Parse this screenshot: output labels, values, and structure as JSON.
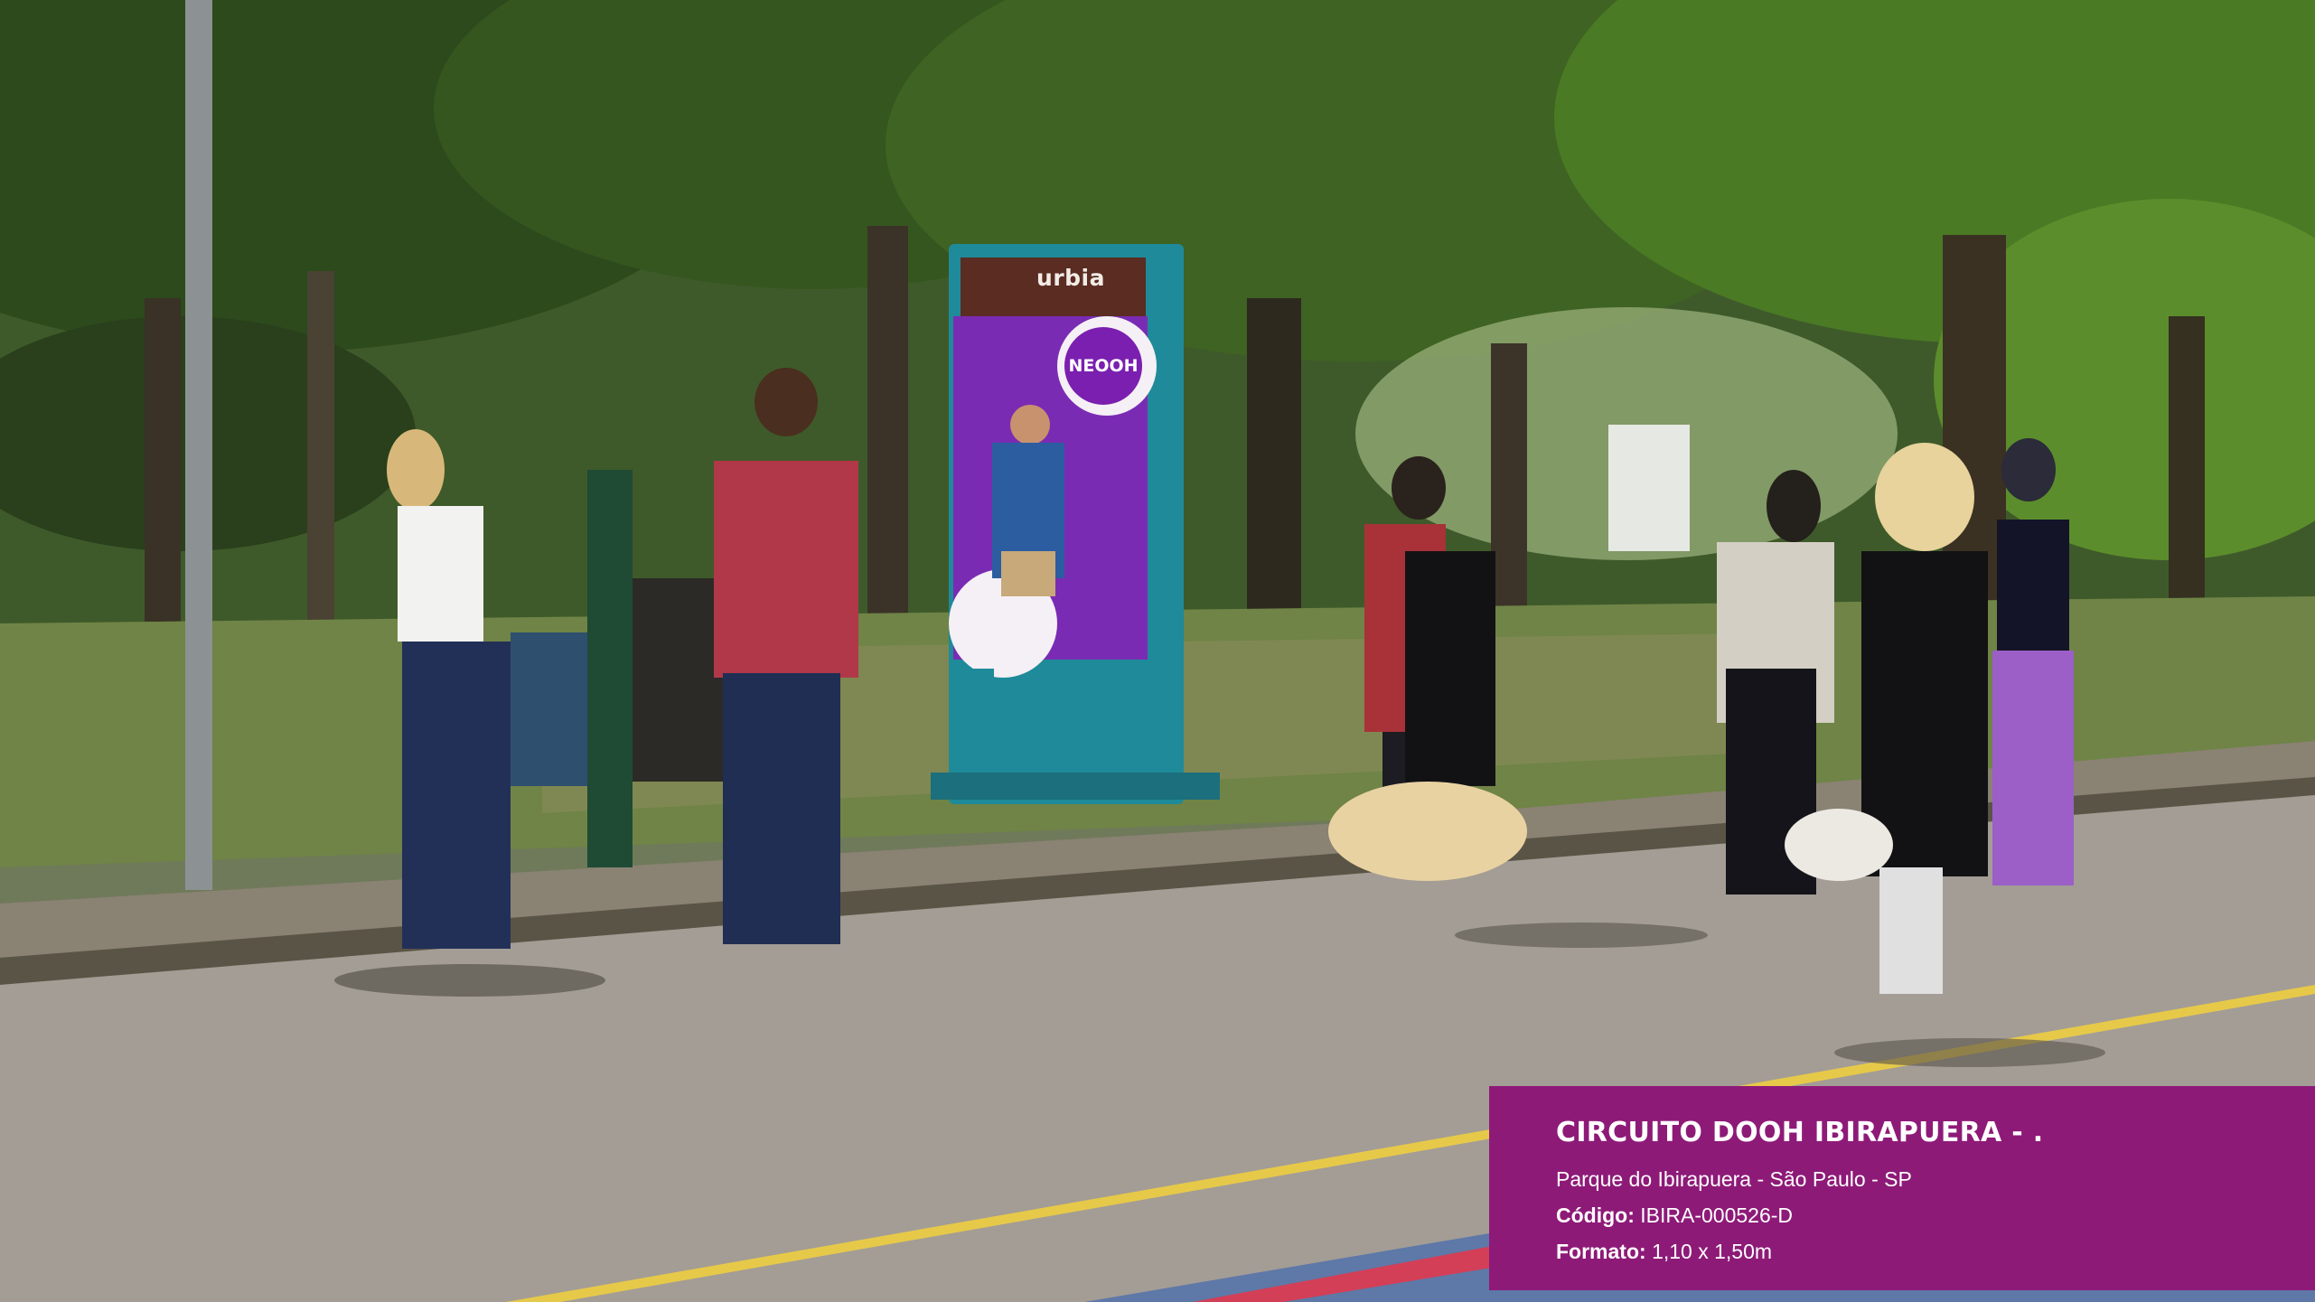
{
  "billboard": {
    "brand": "urbia",
    "badge": "NEOOH"
  },
  "info": {
    "title": "CIRCUITO DOOH IBIRAPUERA - .",
    "location": "Parque do Ibirapuera - São Paulo - SP",
    "code_label": "Código:",
    "code_value": "IBIRA-000526-D",
    "format_label": "Formato:",
    "format_value": "1,10 x 1,50m"
  },
  "colors": {
    "panel": "#8e1a78",
    "billboard_frame": "#1f8a9a",
    "billboard_screen": "#7a2bb3"
  }
}
